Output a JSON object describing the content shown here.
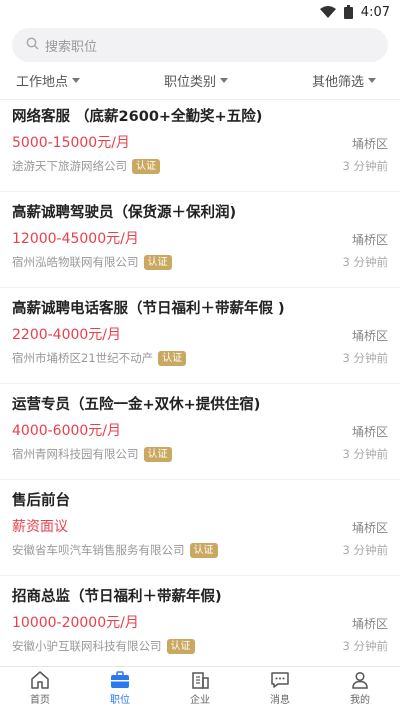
{
  "status_bar": {
    "time": "4:07"
  },
  "search": {
    "placeholder": "搜索职位"
  },
  "filters": [
    {
      "label": "工作地点"
    },
    {
      "label": "职位类别"
    },
    {
      "label": "其他筛选"
    }
  ],
  "jobs": [
    {
      "title": "网络客服 （底薪2600+全勤奖+五险)",
      "salary": "5000-15000元/月",
      "district": "埇桥区",
      "company": "途游天下旅游网络公司",
      "badge": "认证",
      "time": "3 分钟前"
    },
    {
      "title": "高薪诚聘驾驶员（保货源＋保利润)",
      "salary": "12000-45000元/月",
      "district": "埇桥区",
      "company": "宿州泓皓物联网有限公司",
      "badge": "认证",
      "time": "3 分钟前"
    },
    {
      "title": "高薪诚聘电话客服（节日福利＋带薪年假 )",
      "salary": "2200-4000元/月",
      "district": "埇桥区",
      "company": "宿州市埇桥区21世纪不动产",
      "badge": "认证",
      "time": "3 分钟前"
    },
    {
      "title": "运营专员（五险一金+双休+提供住宿)",
      "salary": "4000-6000元/月",
      "district": "埇桥区",
      "company": "宿州青网科技园有限公司",
      "badge": "认证",
      "time": "3 分钟前"
    },
    {
      "title": "售后前台",
      "salary": "薪资面议",
      "district": "埇桥区",
      "company": "安徽省车呗汽车销售服务有限公司",
      "badge": "认证",
      "time": "3 分钟前"
    },
    {
      "title": "招商总监（节日福利＋带薪年假)",
      "salary": "10000-20000元/月",
      "district": "埇桥区",
      "company": "安徽小驴互联网科技有限公司",
      "badge": "认证",
      "time": "3 分钟前"
    }
  ],
  "tabbar": [
    {
      "label": "首页",
      "icon": "home-icon"
    },
    {
      "label": "职位",
      "icon": "briefcase-icon",
      "active": true
    },
    {
      "label": "企业",
      "icon": "building-icon"
    },
    {
      "label": "消息",
      "icon": "message-icon"
    },
    {
      "label": "我的",
      "icon": "person-icon"
    }
  ],
  "colors": {
    "accent": "#2b78f0",
    "salary": "#e8414b",
    "badge": "#c9a861"
  }
}
